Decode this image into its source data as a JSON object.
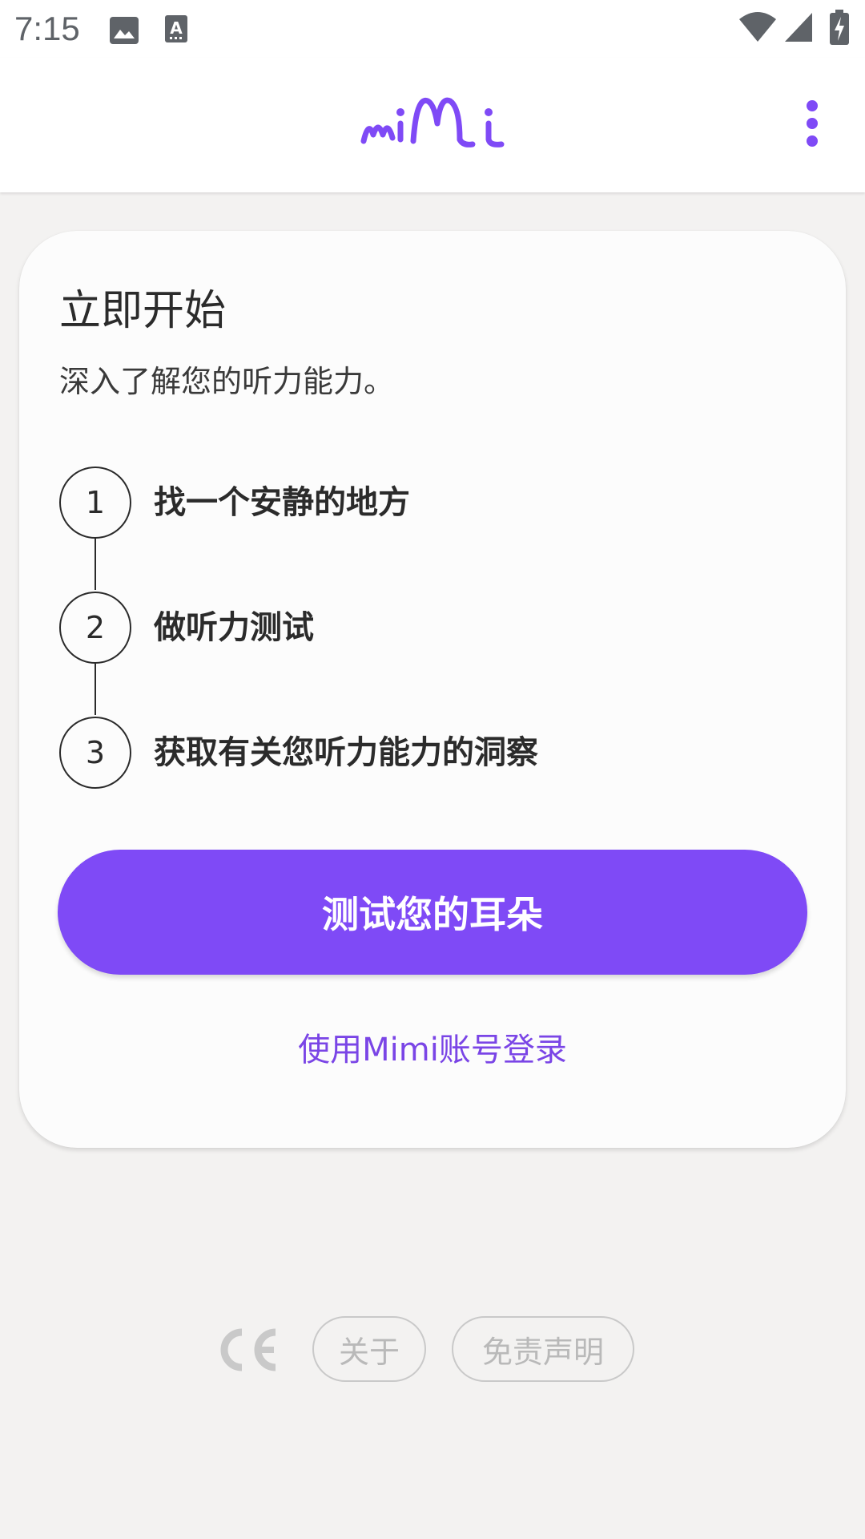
{
  "status_bar": {
    "time": "7:15",
    "icons": [
      "image-icon",
      "text-a-icon",
      "wifi-icon",
      "cell-signal-icon",
      "battery-charging-icon"
    ]
  },
  "app_bar": {
    "logo_icon": "mimi-logo-icon",
    "menu_icon": "more-vert-icon"
  },
  "card": {
    "title": "立即开始",
    "subtitle": "深入了解您的听力能力。",
    "steps": [
      {
        "number": "1",
        "label": "找一个安静的地方"
      },
      {
        "number": "2",
        "label": "做听力测试"
      },
      {
        "number": "3",
        "label": "获取有关您听力能力的洞察"
      }
    ],
    "primary_button": "测试您的耳朵",
    "login_link": "使用Mimi账号登录"
  },
  "footer": {
    "ce_icon": "ce-mark-icon",
    "about": "关于",
    "disclaimer": "免责声明"
  },
  "colors": {
    "accent": "#7f4af6",
    "link": "#7a45e6",
    "background": "#f3f2f1",
    "card": "#fcfcfc"
  }
}
